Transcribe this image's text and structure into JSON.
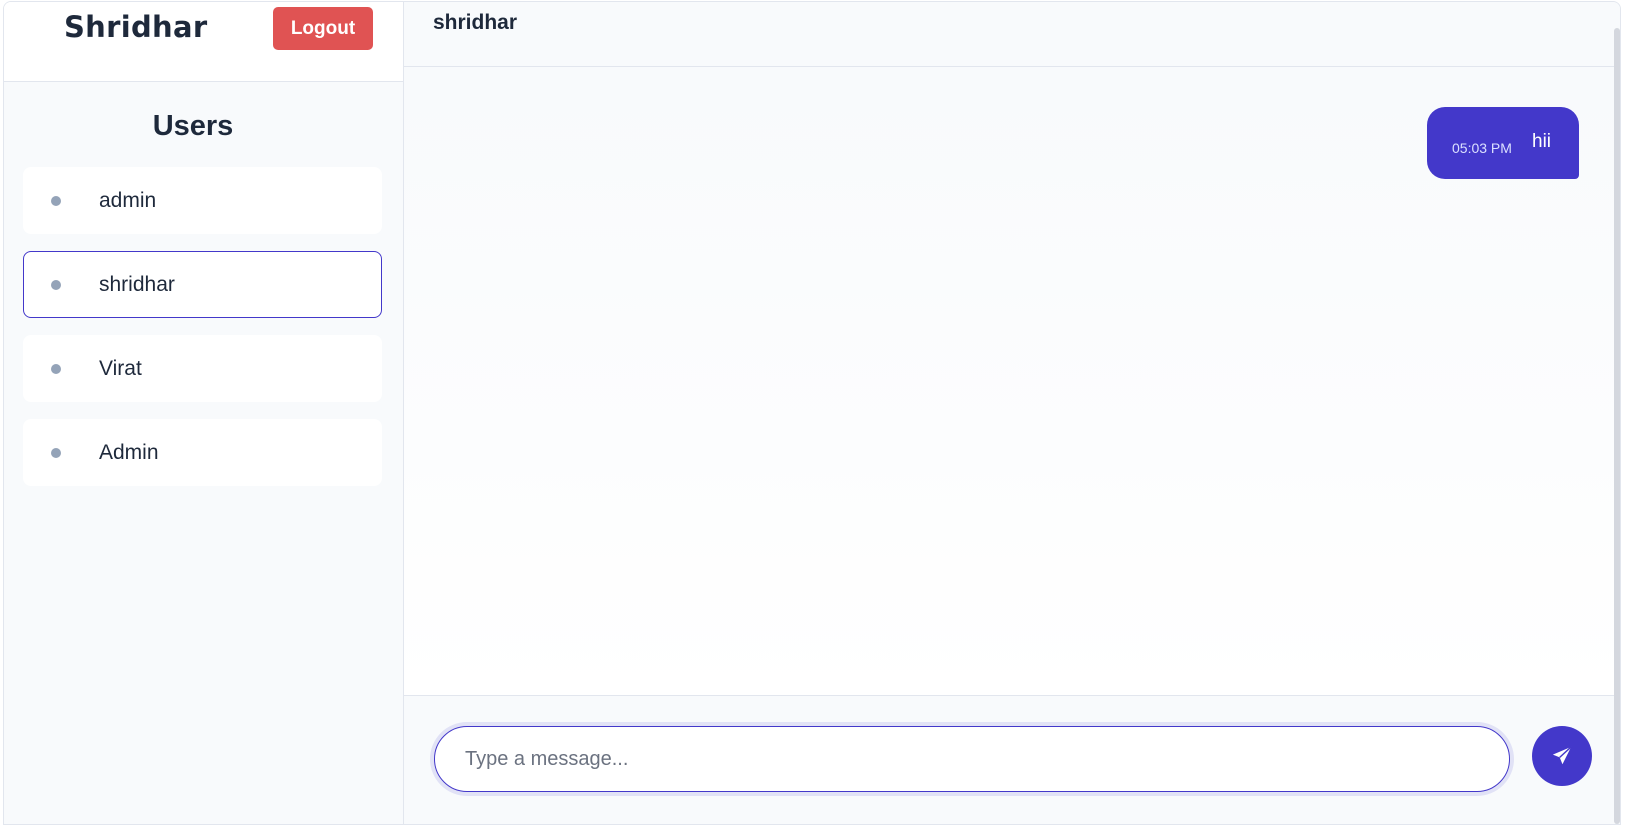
{
  "app": {
    "brand": "Shridhar",
    "logout_label": "Logout"
  },
  "sidebar": {
    "heading": "Users",
    "users": [
      {
        "name": "admin",
        "active": false
      },
      {
        "name": "shridhar",
        "active": true
      },
      {
        "name": "Virat",
        "active": false
      },
      {
        "name": "Admin",
        "active": false
      }
    ]
  },
  "chat": {
    "title": "shridhar",
    "messages": [
      {
        "text": "hii",
        "time": "05:03 PM",
        "outgoing": true
      }
    ],
    "input": {
      "value": "",
      "placeholder": "Type a message..."
    },
    "send_icon": "paper-plane-icon"
  },
  "colors": {
    "accent": "#4338ca",
    "logout": "#e05353",
    "text": "#1e293b",
    "status_dot": "#94a3b8"
  }
}
